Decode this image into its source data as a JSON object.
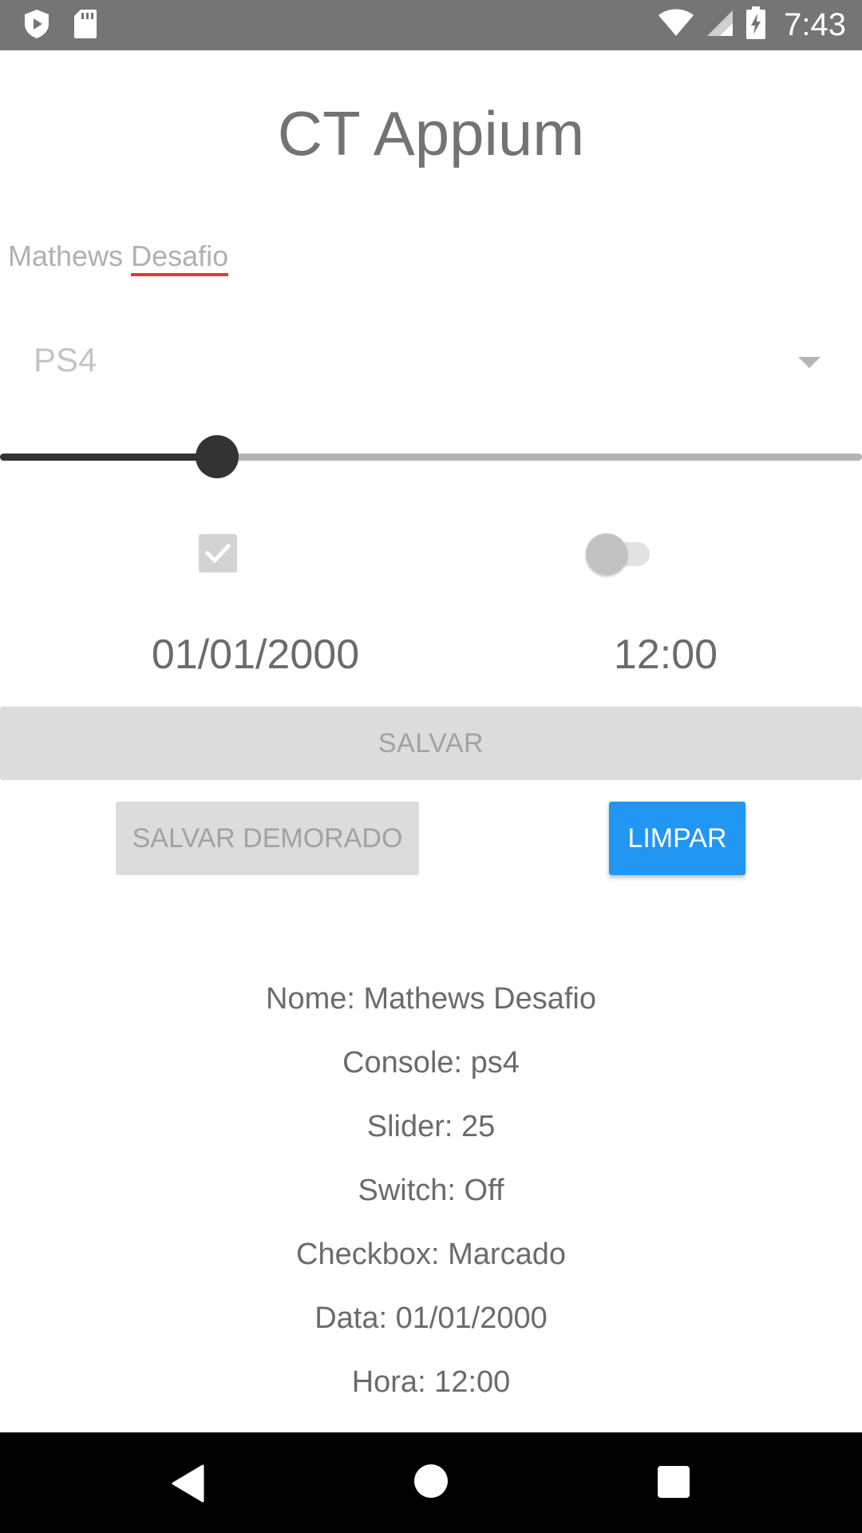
{
  "status_bar": {
    "time": "7:43",
    "icons": [
      "shield-play-icon",
      "sd-card-icon",
      "wifi-icon",
      "cell-signal-icon",
      "battery-charging-icon"
    ]
  },
  "app": {
    "title": "CT Appium"
  },
  "form": {
    "name_word1": "Mathews",
    "name_word2": "Desafio",
    "console_selected": "PS4",
    "slider_value": 25,
    "slider_max": 100,
    "checkbox_checked": true,
    "switch_on": false,
    "date": "01/01/2000",
    "time": "12:00"
  },
  "buttons": {
    "save": "SALVAR",
    "save_slow": "SALVAR DEMORADO",
    "clear": "LIMPAR"
  },
  "results": [
    "Nome: Mathews Desafio",
    "Console: ps4",
    "Slider: 25",
    "Switch: Off",
    "Checkbox: Marcado",
    "Data: 01/01/2000",
    "Hora: 12:00"
  ],
  "colors": {
    "status_bar": "#757575",
    "accent": "#2196f3",
    "error_underline": "#e53935"
  }
}
